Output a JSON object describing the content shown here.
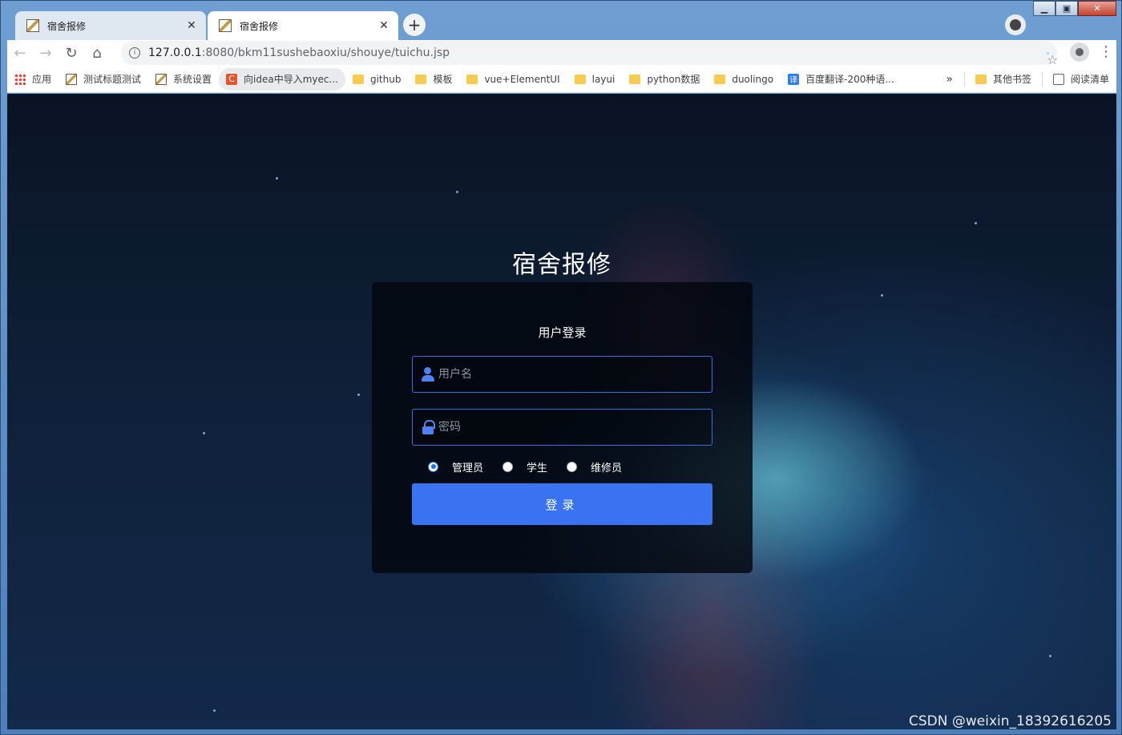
{
  "browser": {
    "tabs": [
      {
        "title": "宿舍报修",
        "close": "✕"
      },
      {
        "title": "宿舍报修",
        "close": "✕"
      }
    ],
    "new_tab": "+",
    "url": {
      "host": "127.0.0.1",
      "path": ":8080/bkm11sushebaoxiu/shouye/tuichu.jsp"
    },
    "window_controls": {
      "minimize": "▁",
      "maximize": "▣",
      "close": "✕"
    }
  },
  "bookmarks": {
    "items": [
      {
        "label": "应用",
        "icon": "apps-icon"
      },
      {
        "label": "测试标题测试",
        "icon": "page-icon"
      },
      {
        "label": "系统设置",
        "icon": "page-icon"
      },
      {
        "label": "向idea中导入myec...",
        "icon": "csdn-icon"
      },
      {
        "label": "github",
        "icon": "folder-icon"
      },
      {
        "label": "模板",
        "icon": "folder-icon"
      },
      {
        "label": "vue+ElementUI",
        "icon": "folder-icon"
      },
      {
        "label": "layui",
        "icon": "folder-icon"
      },
      {
        "label": "python数据",
        "icon": "folder-icon"
      },
      {
        "label": "duolingo",
        "icon": "folder-icon"
      },
      {
        "label": "百度翻译-200种语...",
        "icon": "translate-icon"
      }
    ],
    "overflow": "»",
    "other": "其他书签",
    "reading_list": "阅读清单"
  },
  "page": {
    "title": "宿舍报修",
    "card_title": "用户登录",
    "username_placeholder": "用户名",
    "password_placeholder": "密码",
    "roles": [
      {
        "label": "管理员",
        "checked": true
      },
      {
        "label": "学生",
        "checked": false
      },
      {
        "label": "维修员",
        "checked": false
      }
    ],
    "login_button": "登录",
    "watermark": "CSDN @weixin_18392616205"
  },
  "colors": {
    "accent": "#3a73f2",
    "input_border": "#3b6fe0",
    "card_bg": "#02060e"
  }
}
